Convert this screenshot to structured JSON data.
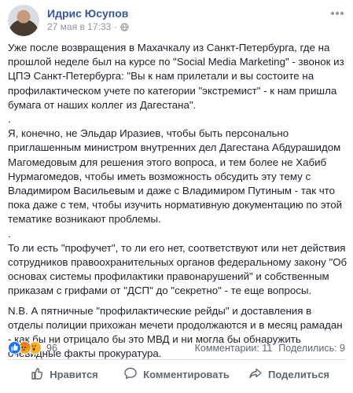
{
  "post": {
    "author": "Идрис Юсупов",
    "date": "27 мая в 17:33",
    "meta_separator": "·",
    "paragraphs": [
      "Уже после возвращения в Махачкалу из Санкт-Петербурга, где на прошлой неделе был на курсе по \"Social Media Marketing\" - звонок из ЦПЭ Санкт-Петербурга: \"Вы к нам прилетали и вы состоите на профилактическом учете по категории \"экстремист\" - к нам пришла бумага от наших коллег из Дагестана\".",
      ".",
      "Я, конечно, не Эльдар Иразиев, чтобы быть персонально приглашенным министром внутренних дел Дагестана Абдурашидом Магомедовым для решения этого вопроса, и тем более не Хабиб Нурмагомедов, чтобы иметь возможность обсудить эту тему с Владимиром Васильевым и даже с Владимиром Путиным - так что пока даже с тем, чтобы изучить нормативную документацию по этой тематике возникают проблемы.",
      ".",
      "То ли есть \"профучет\", то ли его нет, соответствуют или нет действия сотрудников правоохранительных органов федеральному закону \"Об основах системы профилактики правонарушений\" и собственным приказам с грифами от \"ДСП\" до \"секретно\" - те еще вопросы.",
      "N.B. А пятничные \"профилактические рейды\" и доставления в отделы полиции прихожан мечети продолжаются и в месяц рамадан - как бы ни отрицало бы это МВД и ни могла бы обнаружить очевидные факты прокуратура."
    ]
  },
  "reactions": {
    "count": "96",
    "types": [
      "like",
      "angry",
      "wow"
    ],
    "colors": {
      "like": "#1877f2",
      "angry": "#e9710f",
      "wow": "#f7b125"
    }
  },
  "stats": {
    "comments": "Комментарии: 11",
    "shares": "Поделились: 9"
  },
  "actions": {
    "like": "Нравится",
    "comment": "Комментировать",
    "share": "Поделиться"
  },
  "colors": {
    "author": "#365899",
    "meta": "#90949c",
    "text": "#1d2129",
    "action": "#606770"
  }
}
